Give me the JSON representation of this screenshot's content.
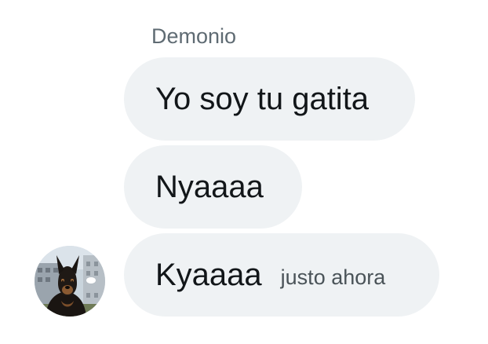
{
  "conversation": {
    "sender_name": "Demonio",
    "messages": [
      {
        "text": "Yo soy tu gatita"
      },
      {
        "text": "Nyaaaa"
      },
      {
        "text": "Kyaaaa",
        "time": "justo ahora"
      }
    ]
  },
  "avatar": {
    "icon": "doberman-avatar-icon"
  },
  "colors": {
    "bubble_bg": "#eff2f4",
    "text": "#121619",
    "sender_text": "#5f6b73",
    "time_text": "#4a5358"
  }
}
